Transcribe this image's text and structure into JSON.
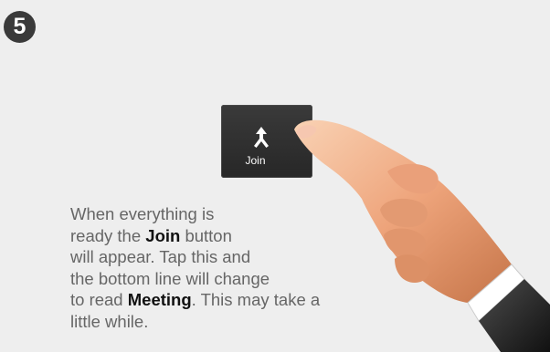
{
  "step": {
    "number": "5"
  },
  "join_button": {
    "label": "Join",
    "icon": "merge-arrows-icon"
  },
  "instructions": {
    "line1": "When everything is",
    "line2_before": "ready the ",
    "line2_bold": "Join",
    "line2_after": " button",
    "line3": "will appear. Tap this and",
    "line4": "the bottom line will change",
    "line5_before": "to read ",
    "line5_bold": "Meeting",
    "line5_after": ". This may take a",
    "line6": "little while."
  },
  "hand": {
    "icon": "pointing-hand-icon"
  },
  "colors": {
    "background": "#eeeeee",
    "button": "#2e2e2e",
    "text": "#666666",
    "text_bold": "#111111"
  }
}
